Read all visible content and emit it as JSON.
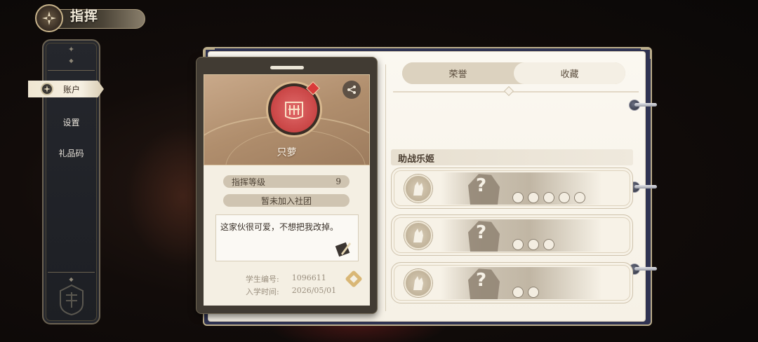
{
  "header": {
    "title": "指挥"
  },
  "sidebar": {
    "items": [
      {
        "label": "账户",
        "active": true
      },
      {
        "label": "设置",
        "active": false
      },
      {
        "label": "礼品码",
        "active": false
      }
    ]
  },
  "profile": {
    "name": "只萝",
    "level_label": "指挥等级",
    "level_value": "9",
    "guild_status": "暂未加入社团",
    "motto": "这家伙很可爱，不想把我改掉。",
    "student_id_label": "学生编号:",
    "student_id_value": "1096611",
    "enroll_label": "入学时间:",
    "enroll_value": "2026/05/01"
  },
  "tabs": [
    {
      "label": "荣誉",
      "active": false
    },
    {
      "label": "收藏",
      "active": true
    }
  ],
  "support_section": {
    "title": "助战乐姬",
    "slots": [
      {
        "placeholder": "?",
        "icons": [
          "shield-icon",
          "sword-icon",
          "book-icon",
          "crosshair-icon",
          "harp-icon"
        ]
      },
      {
        "placeholder": "?",
        "icons": [
          "sword-icon",
          "book-icon",
          "crosshair-icon"
        ]
      },
      {
        "placeholder": "?",
        "icons": [
          "shield-icon",
          "harp-icon"
        ]
      }
    ]
  },
  "colors": {
    "card_accent": "#b08e6d",
    "notebook_cover": "#2f3352",
    "page_bg": "#f6f1e6"
  }
}
